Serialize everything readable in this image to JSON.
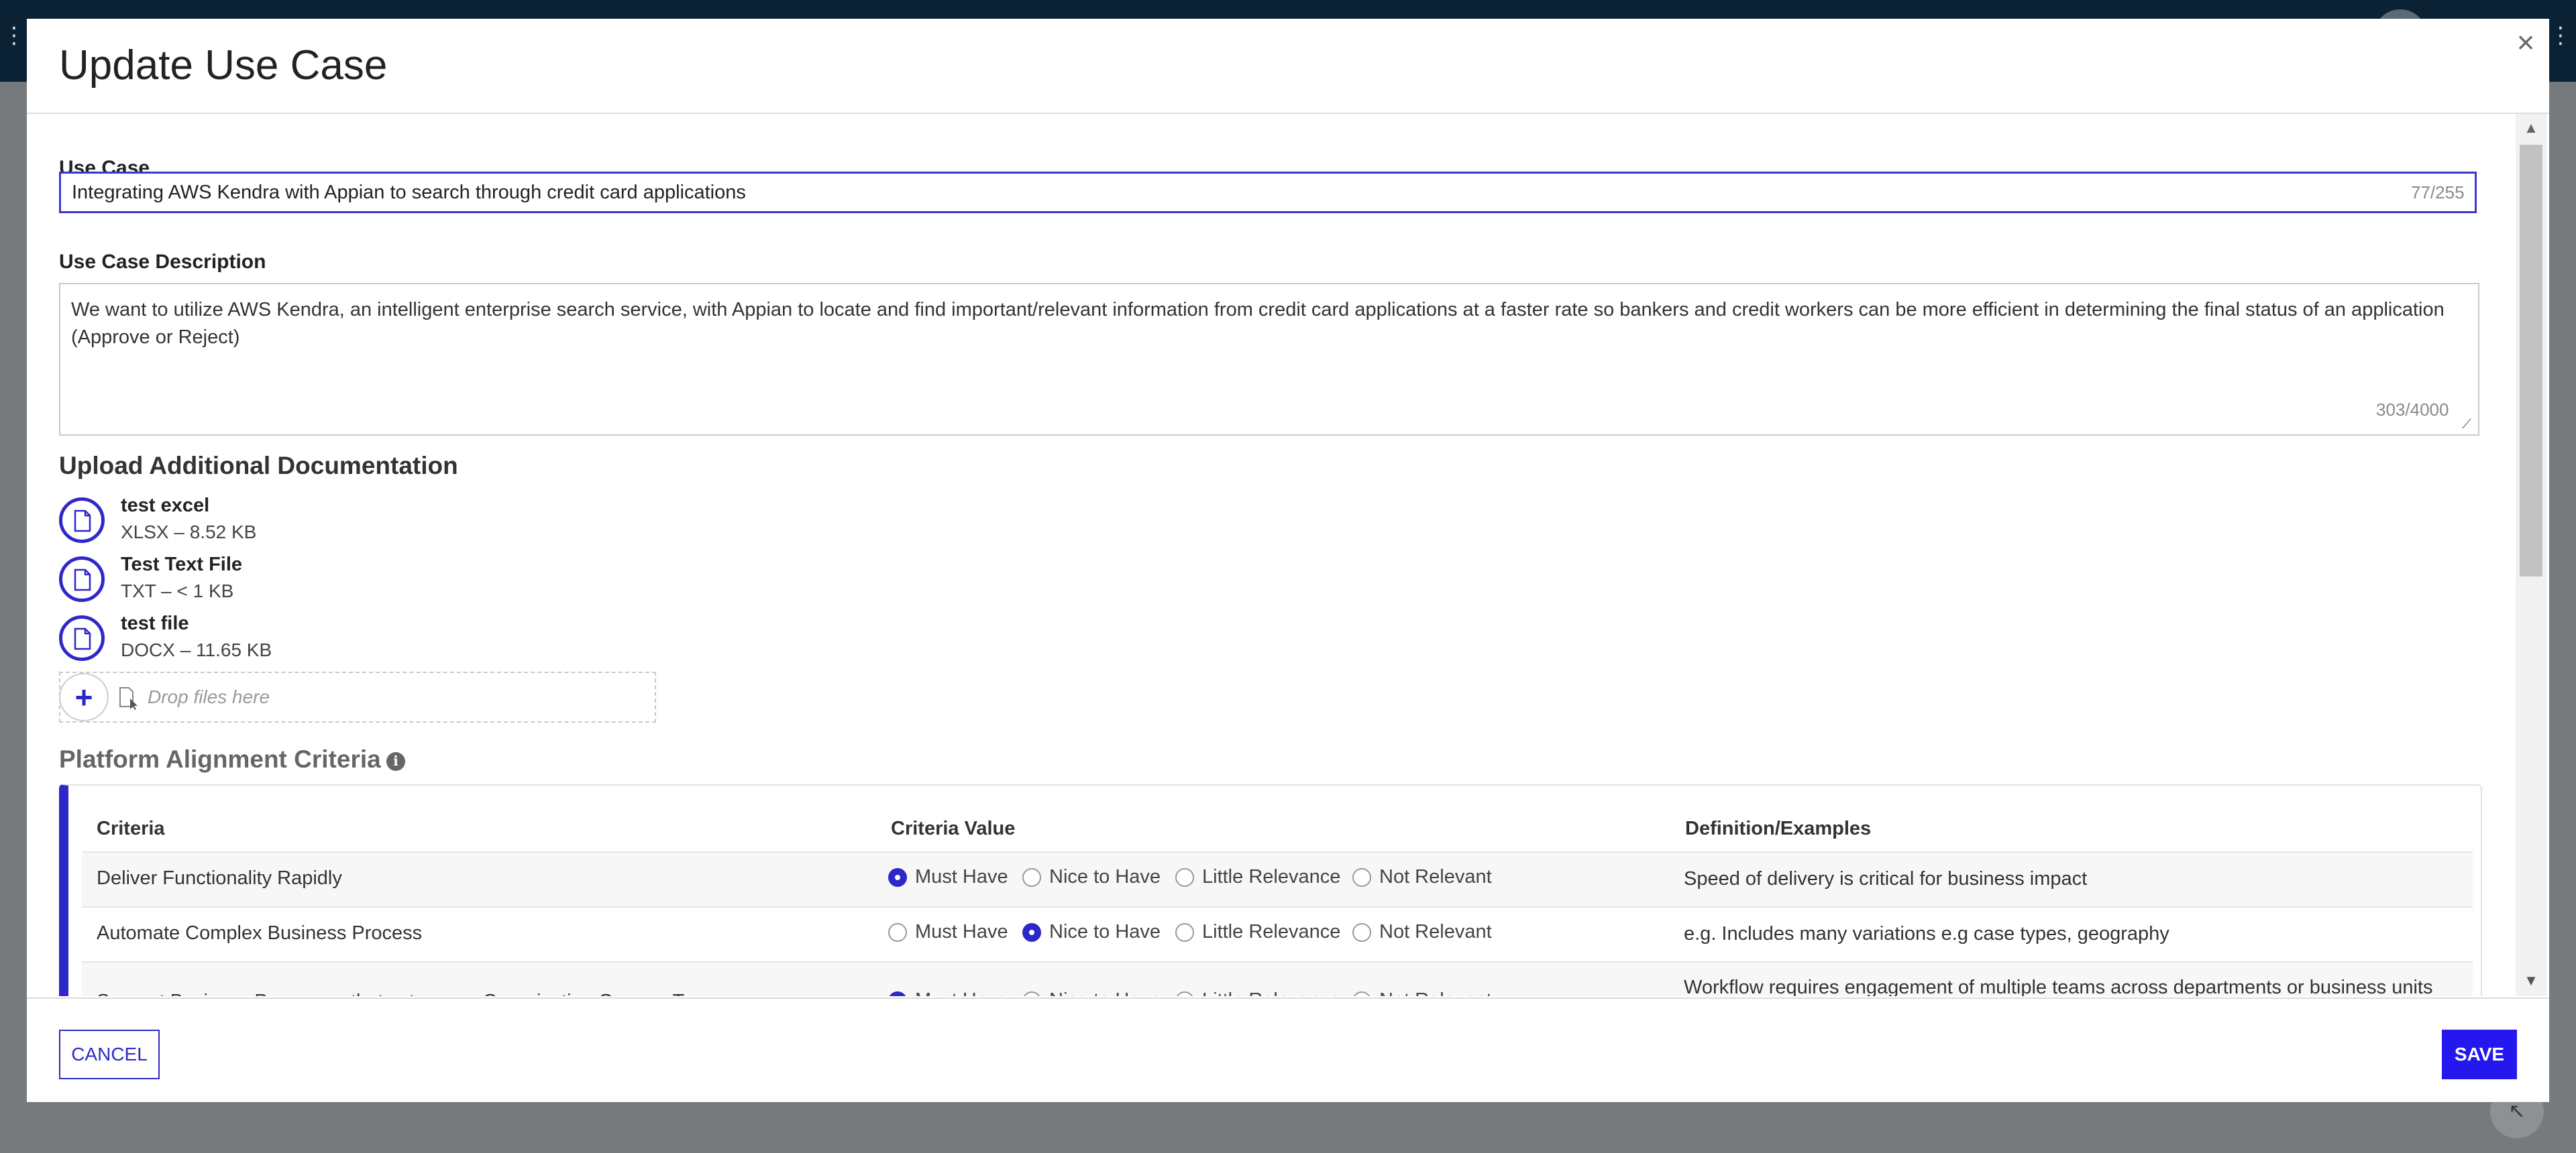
{
  "dialog": {
    "title": "Update Use Case",
    "close_icon": "close-x-icon"
  },
  "use_case": {
    "label": "Use Case",
    "value": "Integrating AWS Kendra with Appian to search through credit card applications",
    "count": "77/255"
  },
  "description": {
    "label": "Use Case Description",
    "value": "We want to utilize AWS Kendra, an intelligent enterprise search service, with Appian to locate and find important/relevant information from credit card applications at a faster rate so bankers and credit workers can be more efficient in determining the final status of an application (Approve or Reject)",
    "count": "303/4000"
  },
  "upload": {
    "heading": "Upload Additional Documentation",
    "files": [
      {
        "name": "test excel",
        "meta": "XLSX – 8.52 KB"
      },
      {
        "name": "Test Text File",
        "meta": "TXT – < 1 KB"
      },
      {
        "name": "test file",
        "meta": "DOCX – 11.65 KB"
      }
    ],
    "drop_text": "Drop files here",
    "add_icon": "plus-icon"
  },
  "platform": {
    "heading": "Platform Alignment Criteria",
    "info_icon": "ℹ",
    "columns": [
      "Criteria",
      "Criteria Value",
      "Definition/Examples"
    ],
    "options": [
      "Must Have",
      "Nice to Have",
      "Little Relevance",
      "Not Relevant"
    ],
    "rows": [
      {
        "criteria": "Deliver Functionality Rapidly",
        "selected": "Must Have",
        "definition": "Speed of delivery is critical for business impact"
      },
      {
        "criteria": "Automate Complex Business Process",
        "selected": "Nice to Have",
        "definition": "e.g. Includes many variations e.g case types, geography"
      },
      {
        "criteria": "Support Business Processes that cut across Organization Groups, Teams",
        "selected": "Must Have",
        "definition": "Workflow requires engagement of multiple teams across departments or business units"
      }
    ]
  },
  "footer": {
    "cancel_label": "CANCEL",
    "save_label": "SAVE"
  },
  "colors": {
    "accent": "#2f28c8",
    "save": "#2418ee",
    "topbar": "#0b2235",
    "overlay": "#777a7c"
  }
}
